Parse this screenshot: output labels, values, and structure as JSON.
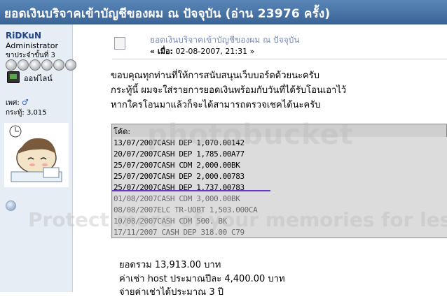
{
  "window": {
    "title": "ยอดเงินบริจาคเข้าบัญชีของผม ณ ปัจจุบัน  (อ่าน 23976 ครั้ง)"
  },
  "user": {
    "name": "RiDKuN",
    "role": "Administrator",
    "rank": "ขาประจำขั้นที่ 3",
    "status": "ออฟไลน์",
    "gender_label": "เพศ:",
    "gender_icon": "male-icon",
    "posts_label": "กระทู้:",
    "posts_count": "3,015"
  },
  "post": {
    "title": "ยอดเงินบริจาคเข้าบัญชีของผม ณ ปัจจุบัน",
    "date_prefix": "« เมื่อ:",
    "date_value": "02-08-2007, 21:31 »",
    "body": [
      "ขอบคุณทุกท่านที่ให้การสนับสนุนเว็บบอร์ดด้วยนะครับ",
      "กระทู้นี้ ผมจะใส่รายการยอดเงินพร้อมกับวันที่ได้รับโอนเอาไว้",
      "หากใครโอนมาแล้วก็จะได้สามารถตรวจเชคได้นะครับ"
    ]
  },
  "code": {
    "label": "โค้ด:",
    "lines": [
      "13/07/2007CASH DEP  1,070.00142",
      "20/07/2007CASH DEP 1,785.00A77",
      "25/07/2007CASH CDM  2,000.00BK",
      "25/07/2007CASH DEP 2,000.00783",
      "25/07/2007CASH DEP 1,737.00783",
      "01/08/2007CASH CDM 3,000.00BK",
      "08/08/2007ELC TR-UOBT   1,503.000CA",
      "10/08/2007CASH CDM 500.   BK",
      "17/11/2007  CASH DEP   318.00  C79"
    ]
  },
  "footer": {
    "total": "ยอดรวม   13,913.00   บาท",
    "host": "ค่าเช่า host ประมาณปีละ   4,400.00   บาท",
    "years": "จ่ายค่าเช่าได้ประมาณ   3   ปี"
  },
  "watermark": {
    "logo": "photobucket",
    "protect": "Protect more of your memories for less!"
  },
  "colors": {
    "titlebar": "#4a76a8",
    "sidebar": "#e6edf5",
    "username": "#224488",
    "code_bg": "#dcdcdc",
    "underline": "#6633cc"
  }
}
